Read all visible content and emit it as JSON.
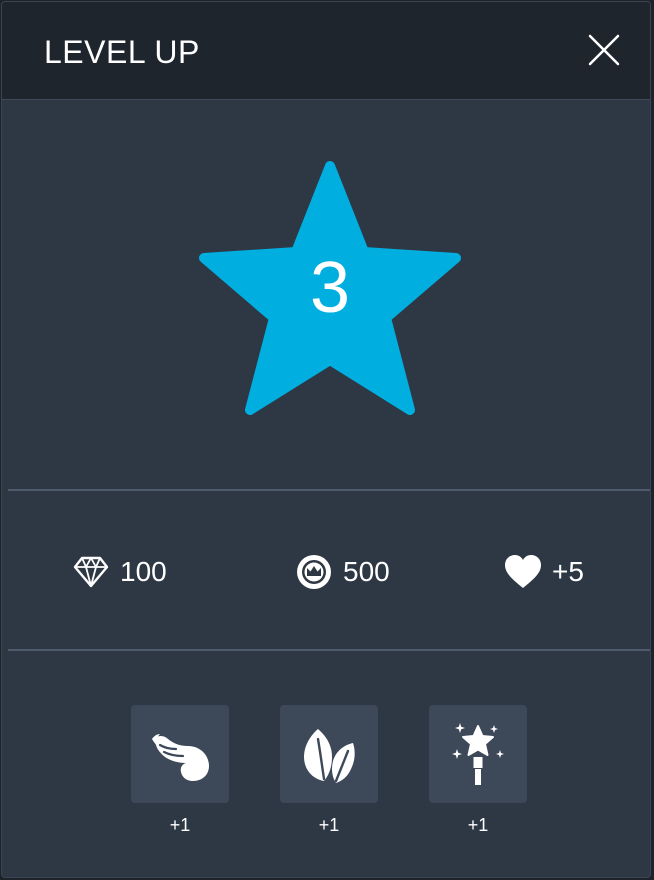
{
  "dialog": {
    "title": "LEVEL UP",
    "close_icon": "close-icon"
  },
  "level": {
    "value": "3",
    "icon": "star-icon",
    "star_color": "#00afe0"
  },
  "rewards": [
    {
      "icon": "diamond-icon",
      "value": "100"
    },
    {
      "icon": "crown-coin-icon",
      "value": "500"
    },
    {
      "icon": "heart-icon",
      "value": "+5"
    }
  ],
  "items": [
    {
      "icon": "wing-icon",
      "label": "+1"
    },
    {
      "icon": "leaf-icon",
      "label": "+1"
    },
    {
      "icon": "magic-wand-icon",
      "label": "+1"
    }
  ],
  "colors": {
    "panel": "#2e3744",
    "header": "#1f252d",
    "tile": "#3d4858",
    "divider": "#4e5b6c"
  }
}
